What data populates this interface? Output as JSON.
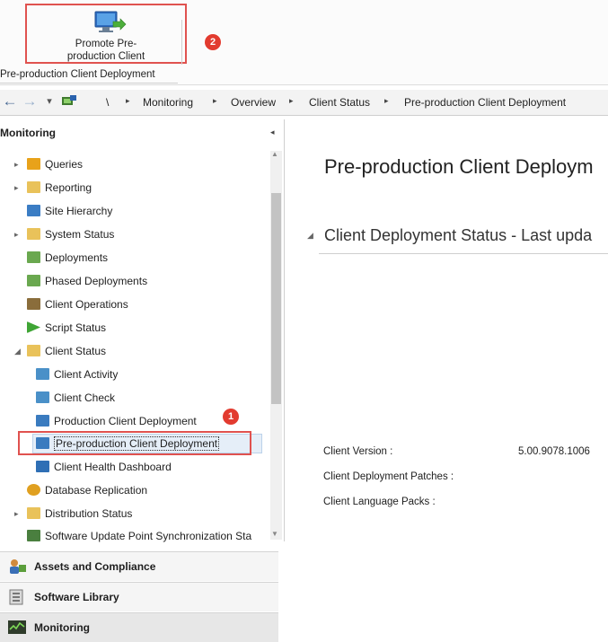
{
  "ribbon": {
    "promote_button_label": "Promote Pre-\nproduction Client",
    "group_label": "Pre-production Client Deployment",
    "callout_2": "2"
  },
  "address": {
    "back": "←",
    "forward": "→",
    "dropdown": "▾",
    "root": "\\",
    "crumbs": [
      "Monitoring",
      "Overview",
      "Client Status",
      "Pre-production Client Deployment"
    ]
  },
  "nav": {
    "header": "Monitoring",
    "collapse": "◂",
    "items": [
      {
        "label": "Queries",
        "icon": "queries-folder-icon",
        "color": "#e8a21a"
      },
      {
        "label": "Reporting",
        "icon": "folder-icon",
        "color": "#e9c25a"
      },
      {
        "label": "Site Hierarchy",
        "icon": "site-hierarchy-icon",
        "color": "#3b7dc4"
      },
      {
        "label": "System Status",
        "icon": "folder-icon",
        "color": "#e9c25a"
      },
      {
        "label": "Deployments",
        "icon": "deployments-icon",
        "color": "#6aa84f"
      },
      {
        "label": "Phased Deployments",
        "icon": "phased-deployments-icon",
        "color": "#6aa84f"
      },
      {
        "label": "Client Operations",
        "icon": "client-operations-icon",
        "color": "#8a6d3b"
      },
      {
        "label": "Script Status",
        "icon": "script-status-icon",
        "color": "#3fa535"
      },
      {
        "label": "Client Status",
        "icon": "folder-open-icon",
        "color": "#e9c25a"
      },
      {
        "label": "Client Activity",
        "icon": "client-activity-icon",
        "color": "#4a90c8"
      },
      {
        "label": "Client Check",
        "icon": "client-check-icon",
        "color": "#4a90c8"
      },
      {
        "label": "Production Client Deployment",
        "icon": "production-deployment-icon",
        "color": "#3a7bbf"
      },
      {
        "label": "Pre-production Client Deployment",
        "icon": "preproduction-deployment-icon",
        "color": "#3a7bbf"
      },
      {
        "label": "Client Health Dashboard",
        "icon": "health-dashboard-icon",
        "color": "#2f6fb5"
      },
      {
        "label": "Database Replication",
        "icon": "database-replication-icon",
        "color": "#e0a020"
      },
      {
        "label": "Distribution Status",
        "icon": "folder-icon",
        "color": "#e9c25a"
      },
      {
        "label": "Software Update Point Synchronization Sta",
        "icon": "sup-sync-icon",
        "color": "#4a7f3f"
      }
    ],
    "callout_1": "1"
  },
  "workspaces": [
    {
      "label": "Assets and Compliance",
      "icon": "assets-compliance-icon"
    },
    {
      "label": "Software Library",
      "icon": "software-library-icon"
    },
    {
      "label": "Monitoring",
      "icon": "monitoring-icon"
    }
  ],
  "content": {
    "title": "Pre-production Client Deploym",
    "section_title": "Client Deployment Status - Last upda",
    "client_version_label": "Client Version :",
    "client_version_value": "5.00.9078.1006",
    "patches_label": "Client Deployment Patches :",
    "language_packs_label": "Client Language Packs :"
  },
  "colors": {
    "callout": "#e23b2f",
    "highlight_border": "#e0524f",
    "selection": "#e5eef8"
  }
}
